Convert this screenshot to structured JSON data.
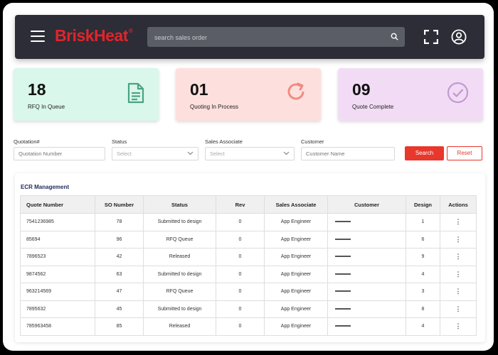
{
  "header": {
    "logo_text": "BriskHeat",
    "logo_mark": "®",
    "search_placeholder": "search sales order",
    "colors": {
      "bar": "#2c2d36",
      "brand": "#e0242b"
    }
  },
  "stats": [
    {
      "value": "18",
      "label": "RFQ In Queue",
      "icon": "document-icon",
      "bg": "#d9f7ea",
      "icon_color": "#4aa384"
    },
    {
      "value": "01",
      "label": "Quoting In Process",
      "icon": "refresh-icon",
      "bg": "#fde0de",
      "icon_color": "#f08b80"
    },
    {
      "value": "09",
      "label": "Quote Complete",
      "icon": "check-circle-icon",
      "bg": "#f2dcf5",
      "icon_color": "#c49ad1"
    }
  ],
  "filters": {
    "quotation": {
      "label": "Quotation#",
      "placeholder": "Quotation Number"
    },
    "status": {
      "label": "Status",
      "placeholder": "Select"
    },
    "associate": {
      "label": "Sales Associate",
      "placeholder": "Select"
    },
    "customer": {
      "label": "Customer",
      "placeholder": "Customer Name"
    },
    "search_button": "Search",
    "reset_button": "Reset",
    "accent": "#e8372c"
  },
  "table": {
    "title": "ECR Management",
    "columns": [
      "Quote Number",
      "SO Number",
      "Status",
      "Rev",
      "Sales Associate",
      "Customer",
      "Design",
      "Actions"
    ],
    "rows": [
      {
        "quote": "7541236985",
        "so": "78",
        "status": "Submitted to design",
        "rev": "0",
        "associate": "App Engineer",
        "design": "1"
      },
      {
        "quote": "85694",
        "so": "96",
        "status": "RFQ Queue",
        "rev": "0",
        "associate": "App Engineer",
        "design": "6"
      },
      {
        "quote": "7896523",
        "so": "42",
        "status": "Released",
        "rev": "0",
        "associate": "App Engineer",
        "design": "9"
      },
      {
        "quote": "9874562",
        "so": "63",
        "status": "Submitted to design",
        "rev": "0",
        "associate": "App Engineer",
        "design": "4"
      },
      {
        "quote": "963214569",
        "so": "47",
        "status": "RFQ Queue",
        "rev": "0",
        "associate": "App Engineer",
        "design": "3"
      },
      {
        "quote": "7895632",
        "so": "45",
        "status": "Submitted to design",
        "rev": "0",
        "associate": "App Engineer",
        "design": "8"
      },
      {
        "quote": "785963458",
        "so": "85",
        "status": "Released",
        "rev": "0",
        "associate": "App Engineer",
        "design": "4"
      }
    ],
    "actions_glyph": "⋮"
  }
}
